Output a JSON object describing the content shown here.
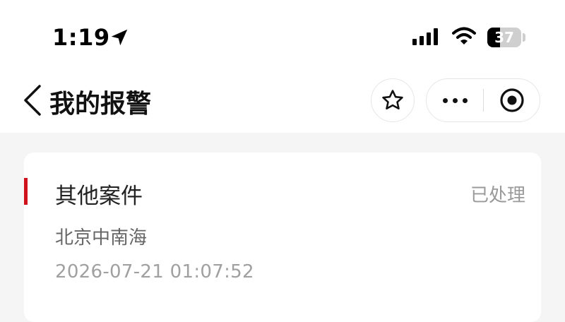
{
  "status_bar": {
    "time": "1:19",
    "location_icon": "location-arrow-icon",
    "signal_icon": "cellular-signal-icon",
    "wifi_icon": "wifi-icon",
    "battery_percent": "37",
    "battery_level": 0.37
  },
  "nav": {
    "back_icon": "chevron-left-icon",
    "title": "我的报警",
    "favorite_icon": "star-outline-icon",
    "more_icon": "ellipsis-icon",
    "close_icon": "target-circle-icon"
  },
  "report": {
    "category": "其他案件",
    "status": "已处理",
    "location": "北京中南海",
    "datetime": "2026-07-21 01:07:52",
    "accent_color": "#d0101a"
  }
}
